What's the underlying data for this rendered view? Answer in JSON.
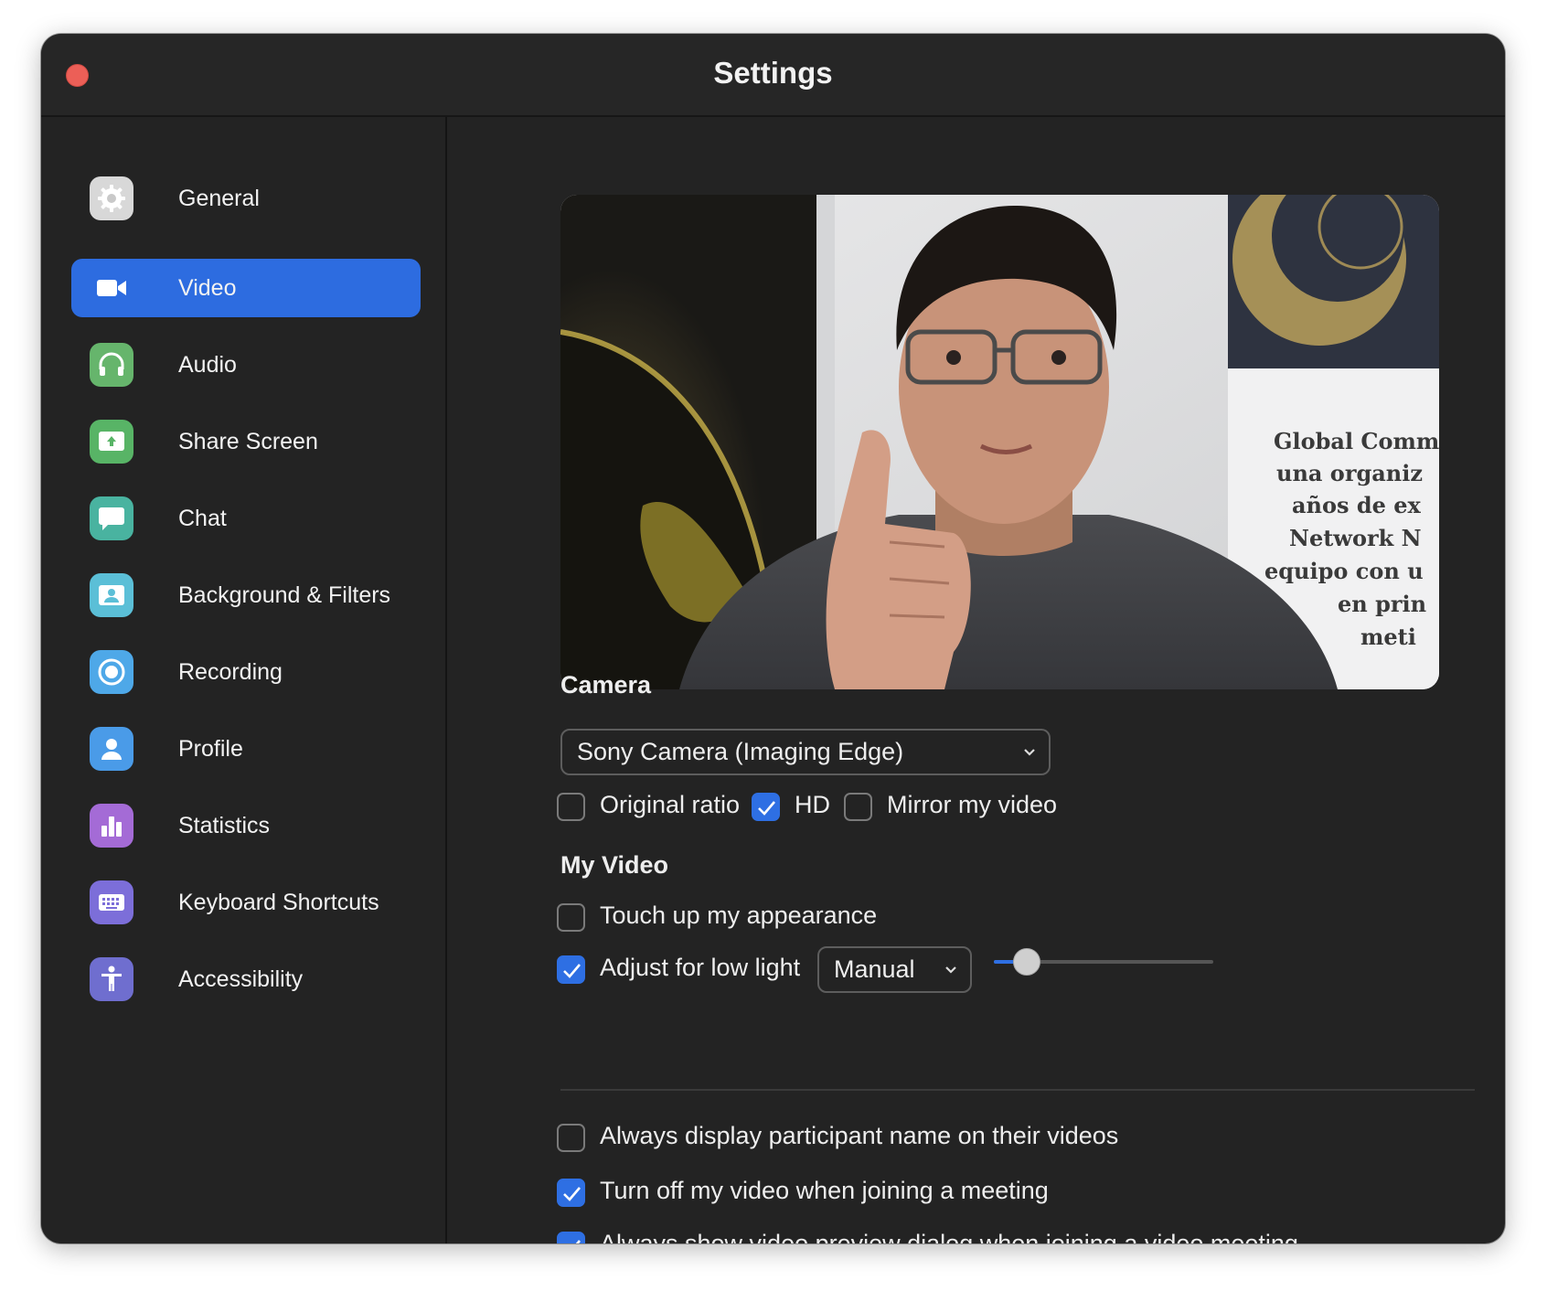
{
  "window": {
    "title": "Settings"
  },
  "sidebar": {
    "items": [
      {
        "label": "General",
        "icon": "gear-icon",
        "color": "#d8d8d8",
        "active": false
      },
      {
        "label": "Video",
        "icon": "video-camera-icon",
        "color": "#2d6ce0",
        "active": true
      },
      {
        "label": "Audio",
        "icon": "headphones-icon",
        "color": "#66b56c",
        "active": false
      },
      {
        "label": "Share Screen",
        "icon": "share-screen-icon",
        "color": "#58b466",
        "active": false
      },
      {
        "label": "Chat",
        "icon": "chat-bubble-icon",
        "color": "#49b3a0",
        "active": false
      },
      {
        "label": "Background & Filters",
        "icon": "background-icon",
        "color": "#5bbfd7",
        "active": false
      },
      {
        "label": "Recording",
        "icon": "record-icon",
        "color": "#4ea8e8",
        "active": false
      },
      {
        "label": "Profile",
        "icon": "profile-icon",
        "color": "#4a9be8",
        "active": false
      },
      {
        "label": "Statistics",
        "icon": "statistics-icon",
        "color": "#a46bd6",
        "active": false
      },
      {
        "label": "Keyboard Shortcuts",
        "icon": "keyboard-icon",
        "color": "#7c6ed9",
        "active": false
      },
      {
        "label": "Accessibility",
        "icon": "accessibility-icon",
        "color": "#6f6ecf",
        "active": false
      }
    ]
  },
  "preview": {
    "banner_text": [
      "Global Comm",
      "una organiz",
      "años de ex",
      "Network N",
      "equipo con u",
      "en prin",
      "meti"
    ]
  },
  "camera": {
    "heading": "Camera",
    "selected": "Sony Camera (Imaging Edge)",
    "options": [
      {
        "label": "Original ratio",
        "checked": false
      },
      {
        "label": "HD",
        "checked": true
      },
      {
        "label": "Mirror my video",
        "checked": false
      }
    ]
  },
  "my_video": {
    "heading": "My Video",
    "touch_up": {
      "label": "Touch up my appearance",
      "checked": false
    },
    "low_light": {
      "label": "Adjust for low light",
      "checked": true,
      "mode": "Manual",
      "level": 0.15
    }
  },
  "general_options": [
    {
      "label": "Always display participant name on their videos",
      "checked": false
    },
    {
      "label": "Turn off my video when joining a meeting",
      "checked": true
    },
    {
      "label": "Always show video preview dialog when joining a video meeting",
      "checked": true
    }
  ],
  "colors": {
    "accent": "#2e6fe3",
    "window_bg": "#232323",
    "close": "#ec5f57"
  }
}
